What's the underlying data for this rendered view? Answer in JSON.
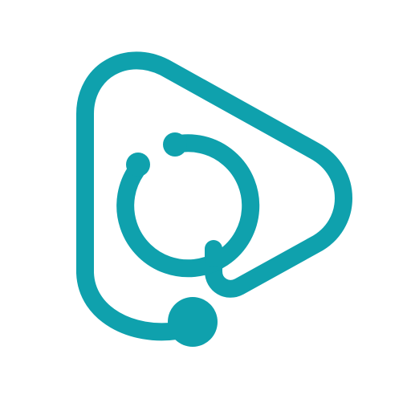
{
  "logo": {
    "icon": "stethoscope-play-icon",
    "color": "#0fa1ad",
    "background": "#ffffff"
  }
}
